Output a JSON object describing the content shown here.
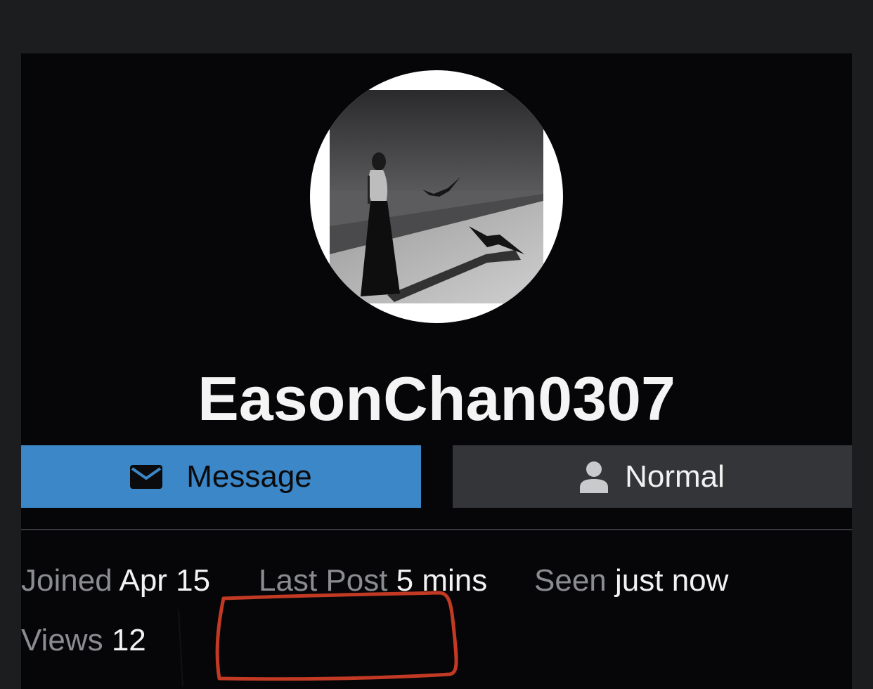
{
  "profile": {
    "username": "EasonChan0307",
    "avatar_alt": "avatar-photo"
  },
  "actions": {
    "message_label": "Message",
    "message_icon": "envelope-icon",
    "normal_label": "Normal",
    "normal_icon": "user-icon"
  },
  "stats": {
    "joined_label": "Joined",
    "joined_value": "Apr 15",
    "last_post_label": "Last Post",
    "last_post_value": "5 mins",
    "seen_label": "Seen",
    "seen_value": "just now",
    "views_label": "Views",
    "views_value": "12"
  },
  "colors": {
    "background": "#1c1d1f",
    "card": "#060608",
    "message_button": "#3b87c8",
    "normal_button": "#333538",
    "annotation": "#c23a24"
  }
}
